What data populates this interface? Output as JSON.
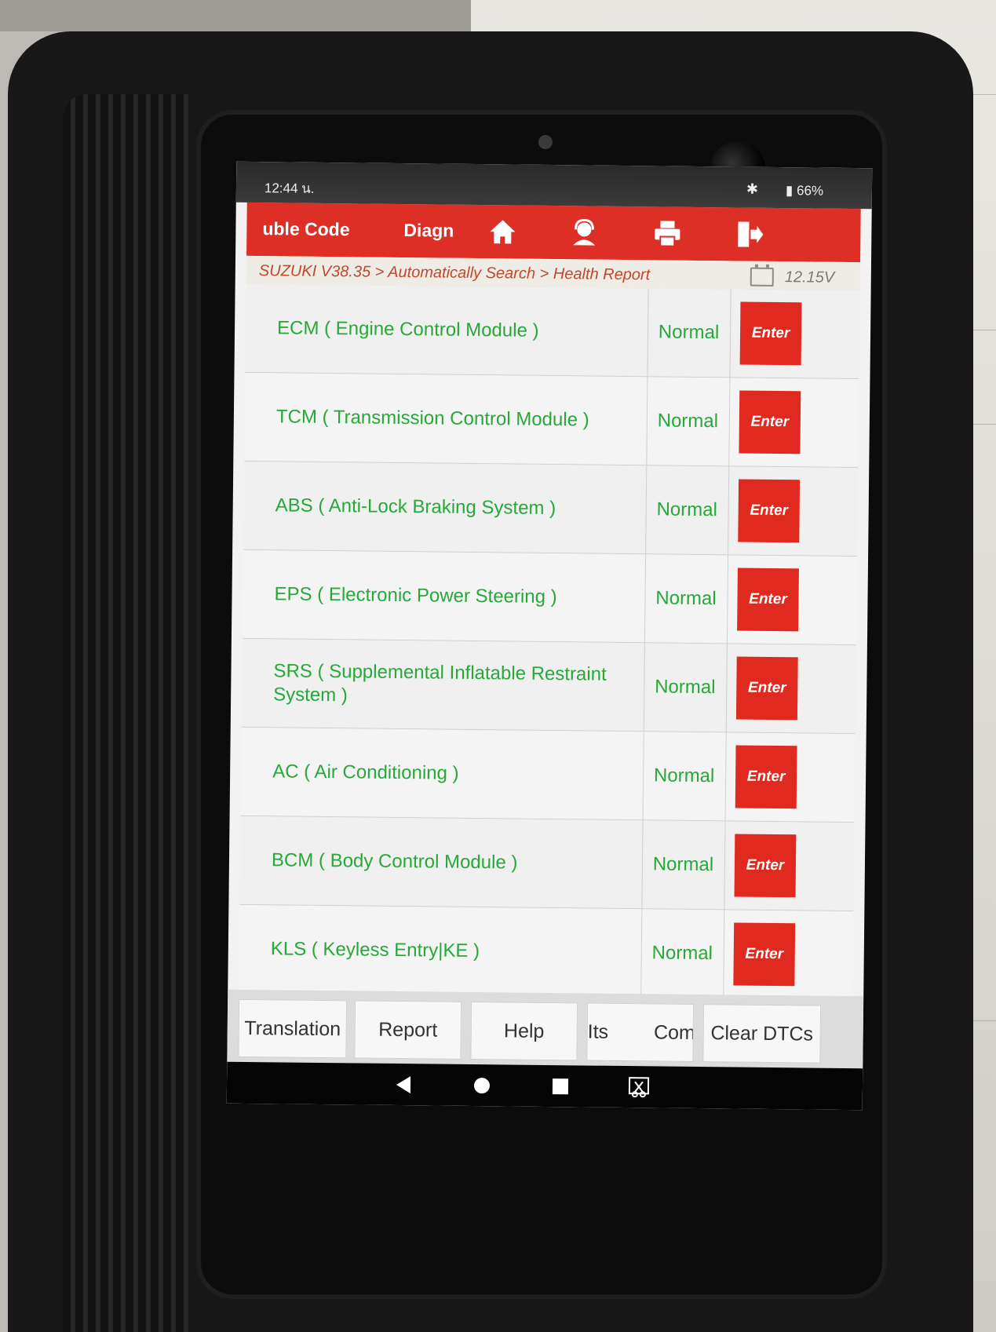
{
  "status_bar": {
    "time": "12:44 น.",
    "battery": "66%"
  },
  "toolbar": {
    "tabs": [
      "uble Code",
      "Diagn"
    ],
    "icons": [
      "home-icon",
      "support-icon",
      "print-icon",
      "exit-icon"
    ]
  },
  "breadcrumb": "SUZUKI V38.35 > Automatically Search > Health Report",
  "voltage": "12.15V",
  "modules": [
    {
      "name": "ECM ( Engine Control Module )",
      "status": "Normal",
      "action": "Enter"
    },
    {
      "name": "TCM ( Transmission Control Module )",
      "status": "Normal",
      "action": "Enter"
    },
    {
      "name": "ABS ( Anti-Lock Braking System )",
      "status": "Normal",
      "action": "Enter"
    },
    {
      "name": "EPS ( Electronic Power Steering )",
      "status": "Normal",
      "action": "Enter"
    },
    {
      "name": "SRS ( Supplemental Inflatable Restraint System )",
      "status": "Normal",
      "action": "Enter"
    },
    {
      "name": "AC ( Air Conditioning )",
      "status": "Normal",
      "action": "Enter"
    },
    {
      "name": "BCM ( Body Control Module )",
      "status": "Normal",
      "action": "Enter"
    },
    {
      "name": "KLS ( Keyless Entry|KE )",
      "status": "Normal",
      "action": "Enter"
    }
  ],
  "bottom_buttons": [
    "Translation",
    "Report",
    "Help",
    "Its",
    "Com",
    "Clear DTCs"
  ],
  "colors": {
    "accent": "#dd2f25",
    "status_green": "#27a838",
    "breadcrumb": "#c2462b"
  }
}
